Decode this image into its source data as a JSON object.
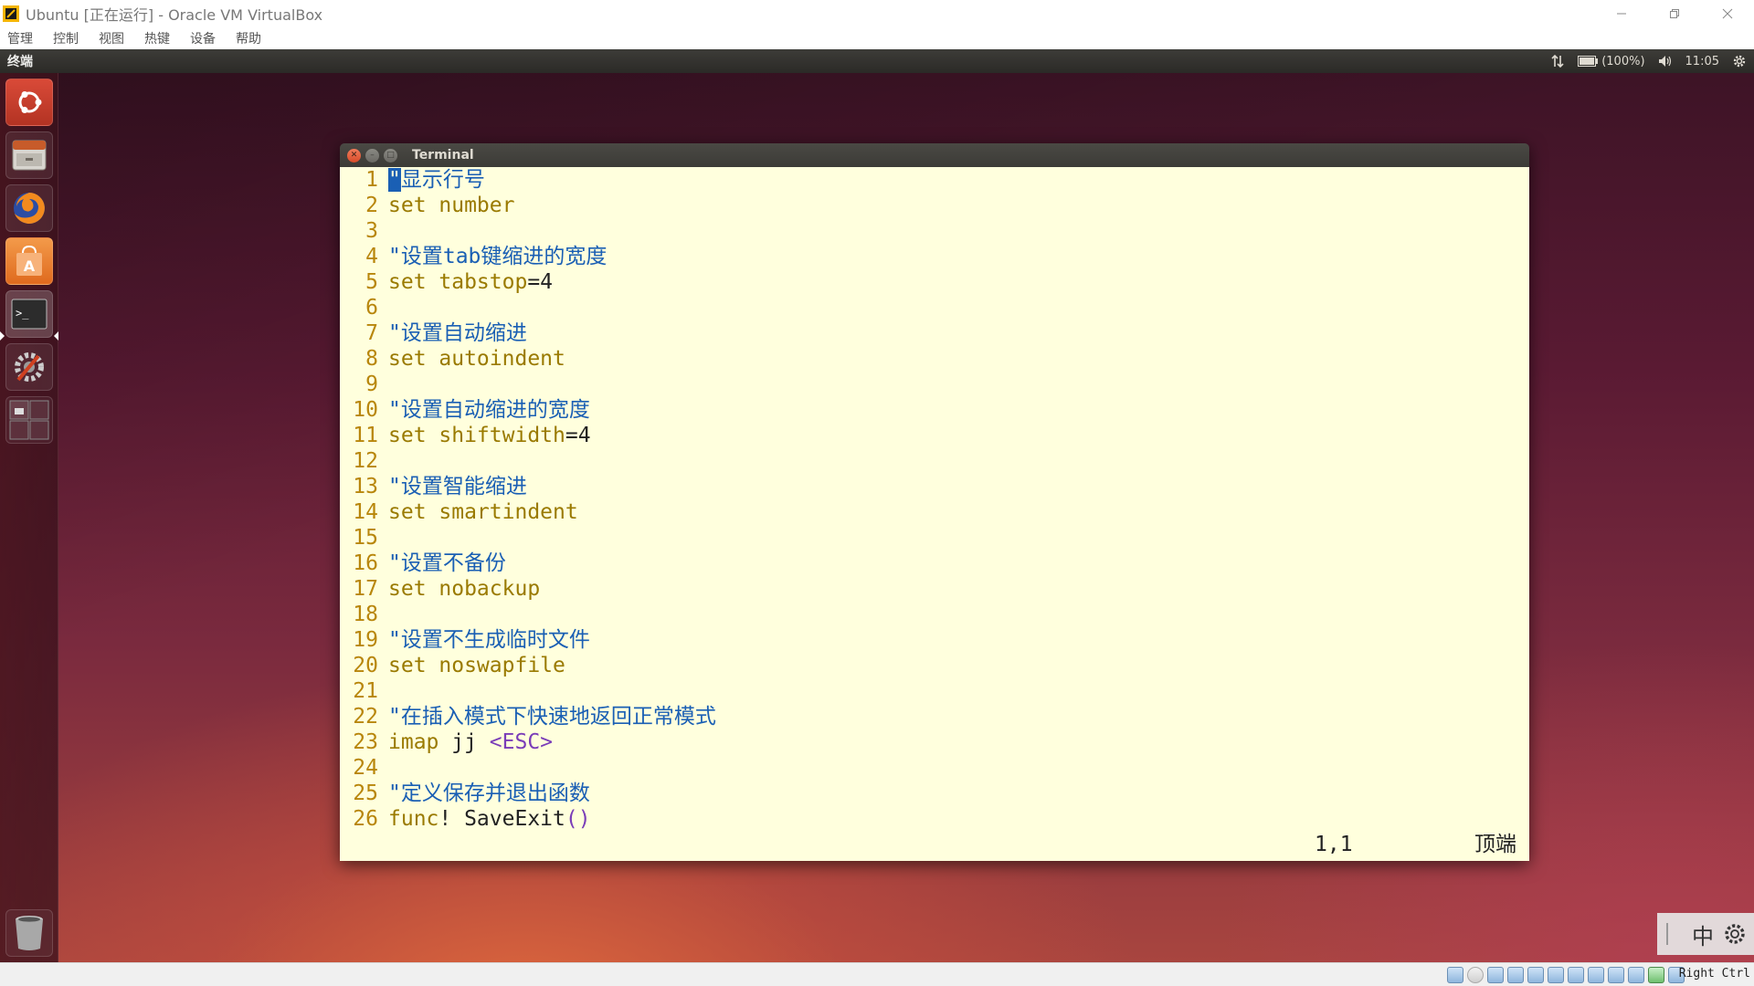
{
  "host": {
    "title": "Ubuntu [正在运行] - Oracle VM VirtualBox",
    "menu": [
      "管理",
      "控制",
      "视图",
      "热键",
      "设备",
      "帮助"
    ],
    "host_key": "Right Ctrl"
  },
  "guest": {
    "panel_title": "终端",
    "indicators": {
      "battery": "(100%)",
      "time": "11:05"
    },
    "launcher": [
      {
        "name": "dash-home-icon"
      },
      {
        "name": "files-icon"
      },
      {
        "name": "firefox-icon"
      },
      {
        "name": "software-center-icon"
      },
      {
        "name": "terminal-icon"
      },
      {
        "name": "system-settings-icon"
      },
      {
        "name": "workspace-switcher-icon"
      },
      {
        "name": "trash-icon"
      }
    ]
  },
  "terminal": {
    "title": "Terminal",
    "lines": [
      {
        "n": "1",
        "parts": [
          {
            "t": "\"",
            "c": "cursor"
          },
          {
            "t": "显示行号",
            "c": "c-comment"
          }
        ]
      },
      {
        "n": "2",
        "parts": [
          {
            "t": "set",
            "c": "c-kw"
          },
          {
            "t": " number",
            "c": "c-kw"
          }
        ]
      },
      {
        "n": "3",
        "parts": []
      },
      {
        "n": "4",
        "parts": [
          {
            "t": "\"设置tab键缩进的宽度",
            "c": "c-comment"
          }
        ]
      },
      {
        "n": "5",
        "parts": [
          {
            "t": "set",
            "c": "c-kw"
          },
          {
            "t": " tabstop",
            "c": "c-kw"
          },
          {
            "t": "=4",
            "c": "c-plain"
          }
        ]
      },
      {
        "n": "6",
        "parts": []
      },
      {
        "n": "7",
        "parts": [
          {
            "t": "\"设置自动缩进",
            "c": "c-comment"
          }
        ]
      },
      {
        "n": "8",
        "parts": [
          {
            "t": "set",
            "c": "c-kw"
          },
          {
            "t": " autoindent",
            "c": "c-kw"
          }
        ]
      },
      {
        "n": "9",
        "parts": []
      },
      {
        "n": "10",
        "parts": [
          {
            "t": "\"设置自动缩进的宽度",
            "c": "c-comment"
          }
        ]
      },
      {
        "n": "11",
        "parts": [
          {
            "t": "set",
            "c": "c-kw"
          },
          {
            "t": " shiftwidth",
            "c": "c-kw"
          },
          {
            "t": "=4",
            "c": "c-plain"
          }
        ]
      },
      {
        "n": "12",
        "parts": []
      },
      {
        "n": "13",
        "parts": [
          {
            "t": "\"设置智能缩进",
            "c": "c-comment"
          }
        ]
      },
      {
        "n": "14",
        "parts": [
          {
            "t": "set",
            "c": "c-kw"
          },
          {
            "t": " smartindent",
            "c": "c-kw"
          }
        ]
      },
      {
        "n": "15",
        "parts": []
      },
      {
        "n": "16",
        "parts": [
          {
            "t": "\"设置不备份",
            "c": "c-comment"
          }
        ]
      },
      {
        "n": "17",
        "parts": [
          {
            "t": "set",
            "c": "c-kw"
          },
          {
            "t": " nobackup",
            "c": "c-kw"
          }
        ]
      },
      {
        "n": "18",
        "parts": []
      },
      {
        "n": "19",
        "parts": [
          {
            "t": "\"设置不生成临时文件",
            "c": "c-comment"
          }
        ]
      },
      {
        "n": "20",
        "parts": [
          {
            "t": "set",
            "c": "c-kw"
          },
          {
            "t": " noswapfile",
            "c": "c-kw"
          }
        ]
      },
      {
        "n": "21",
        "parts": []
      },
      {
        "n": "22",
        "parts": [
          {
            "t": "\"在插入模式下快速地返回正常模式",
            "c": "c-comment"
          }
        ]
      },
      {
        "n": "23",
        "parts": [
          {
            "t": "imap",
            "c": "c-kw"
          },
          {
            "t": " jj ",
            "c": "c-plain"
          },
          {
            "t": "<ESC>",
            "c": "c-angle"
          }
        ]
      },
      {
        "n": "24",
        "parts": []
      },
      {
        "n": "25",
        "parts": [
          {
            "t": "\"定义保存并退出函数",
            "c": "c-comment"
          }
        ]
      },
      {
        "n": "26",
        "parts": [
          {
            "t": "func",
            "c": "c-kw"
          },
          {
            "t": "! SaveExit",
            "c": "c-plain"
          },
          {
            "t": "()",
            "c": "c-angle"
          }
        ]
      }
    ],
    "status_position": "1,1",
    "status_scroll": "顶端"
  },
  "ime": {
    "mode": "中"
  }
}
